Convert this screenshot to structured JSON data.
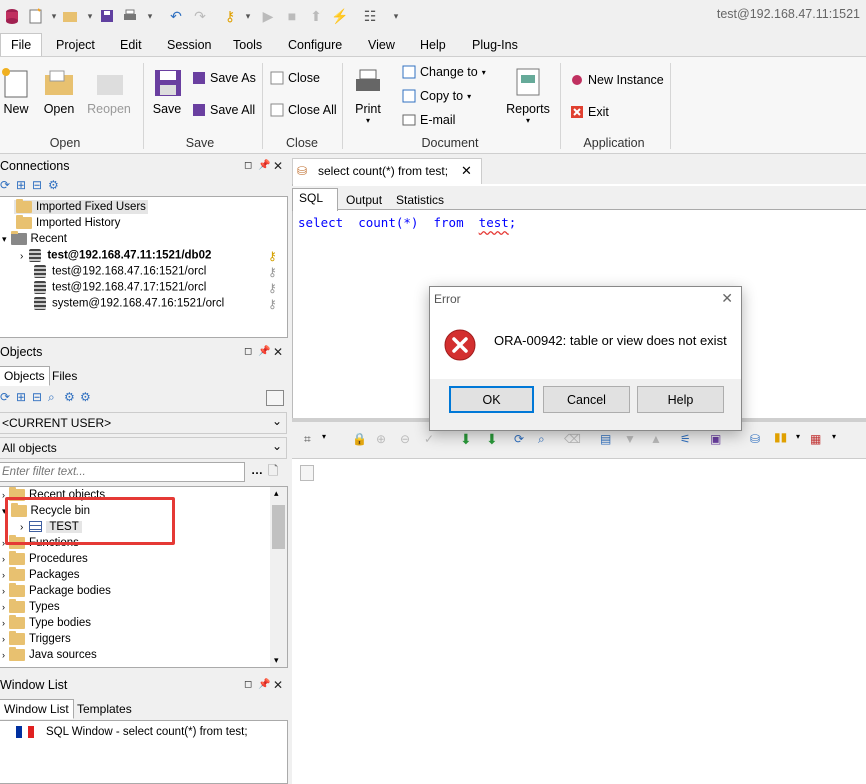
{
  "window_title": "test@192.168.47.11:1521",
  "menu": [
    "File",
    "Project",
    "Edit",
    "Session",
    "Tools",
    "Configure",
    "View",
    "Help",
    "Plug-Ins"
  ],
  "ribbon": {
    "open_group": {
      "label": "Open",
      "new": "New",
      "open": "Open",
      "reopen": "Reopen"
    },
    "save_group": {
      "label": "Save",
      "save": "Save",
      "save_as": "Save As",
      "save_all": "Save All"
    },
    "close_group": {
      "label": "Close",
      "close": "Close",
      "close_all": "Close All"
    },
    "document_group": {
      "label": "Document",
      "print": "Print",
      "change_to": "Change to",
      "copy_to": "Copy to",
      "email": "E-mail",
      "reports": "Reports"
    },
    "application_group": {
      "label": "Application",
      "new_instance": "New Instance",
      "exit": "Exit"
    }
  },
  "connections": {
    "title": "Connections",
    "items": [
      "Imported Fixed Users",
      "Imported History",
      "Recent",
      "test@192.168.47.11:1521/db02",
      "test@192.168.47.16:1521/orcl",
      "test@192.168.47.17:1521/orcl",
      "system@192.168.47.16:1521/orcl"
    ]
  },
  "objects": {
    "title": "Objects",
    "tabs": [
      "Objects",
      "Files"
    ],
    "user_select": "<CURRENT USER>",
    "filter_select": "All objects",
    "filter_placeholder": "Enter filter text...",
    "tree": [
      "Recent objects",
      "Recycle bin",
      "TEST",
      "Functions",
      "Procedures",
      "Packages",
      "Package bodies",
      "Types",
      "Type bodies",
      "Triggers",
      "Java sources"
    ]
  },
  "window_list": {
    "title": "Window List",
    "tabs": [
      "Window List",
      "Templates"
    ],
    "items": [
      "SQL Window - select count(*) from test;"
    ]
  },
  "editor": {
    "tab_title": "select count(*) from test;",
    "subtabs": [
      "SQL",
      "Output",
      "Statistics"
    ],
    "sql": {
      "kw1": "select",
      "fn": "count(*)",
      "kw2": "from",
      "tbl": "test",
      "end": ";"
    }
  },
  "dialog": {
    "title": "Error",
    "message": "ORA-00942: table or view does not exist",
    "buttons": {
      "ok": "OK",
      "cancel": "Cancel",
      "help": "Help"
    }
  },
  "colors": {
    "keyword": "#0000ff",
    "highlight_box": "#e53935",
    "error_red": "#d32f2f"
  }
}
